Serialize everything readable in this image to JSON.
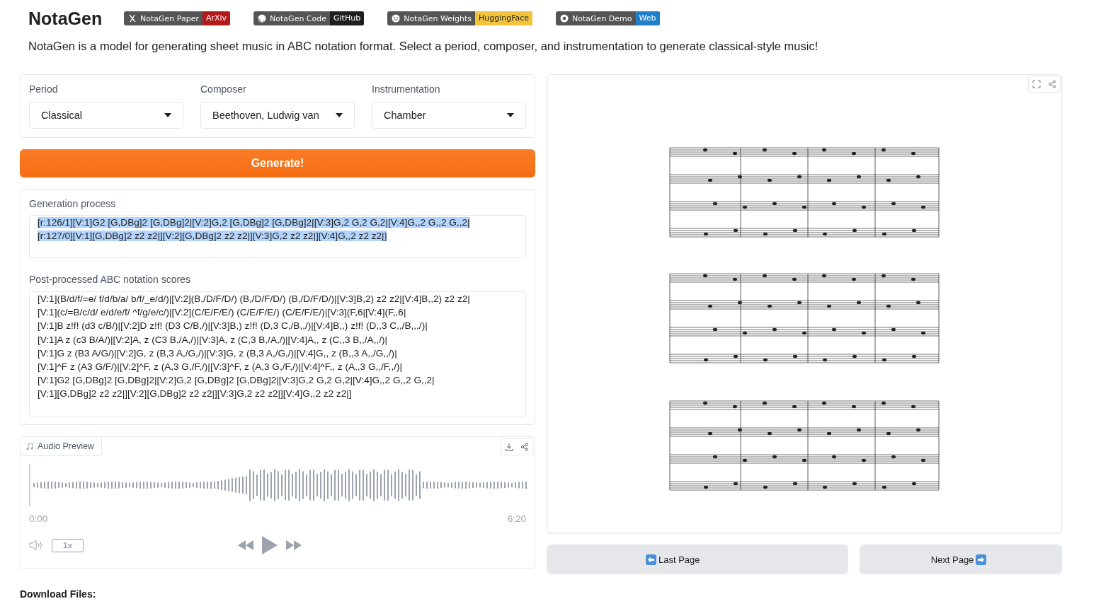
{
  "header": {
    "title": "NotaGen",
    "badges": [
      {
        "kind": "paper",
        "label": "NotaGen Paper",
        "tag": "ArXiv",
        "color": "#b31b1b"
      },
      {
        "kind": "code",
        "label": "NotaGen Code",
        "tag": "GitHub",
        "color": "#1f1f1f"
      },
      {
        "kind": "weights",
        "label": "NotaGen Weights",
        "tag": "HuggingFace",
        "color": "#f2c43d"
      },
      {
        "kind": "demo",
        "label": "NotaGen Demo",
        "tag": "Web",
        "color": "#1f7fc9"
      }
    ],
    "description": "NotaGen is a model for generating sheet music in ABC notation format. Select a period, composer, and instrumentation to generate classical-style music!"
  },
  "selectors": [
    {
      "label": "Period",
      "value": "Classical"
    },
    {
      "label": "Composer",
      "value": "Beethoven, Ludwig van"
    },
    {
      "label": "Instrumentation",
      "value": "Chamber"
    }
  ],
  "generate_button": "Generate!",
  "generation_process": {
    "label": "Generation process",
    "selected": true,
    "lines": [
      "[r:126/1][V:1]G2 [G,DBg]2 [G,DBg]2|[V:2]G,2 [G,DBg]2 [G,DBg]2|[V:3]G,2 G,2 G,2|[V:4]G,,2 G,,2 G,,2|",
      "[r:127/0][V:1][G,DBg]2 z2 z2|][V:2][G,DBg]2 z2 z2|][V:3]G,2 z2 z2|][V:4]G,,2 z2 z2|]"
    ]
  },
  "abc_scores": {
    "label": "Post-processed ABC notation scores",
    "lines": [
      "[V:1](B/d/f/=e/ f/d/b/a/ b/f/_e/d/)|[V:2](B,/D/F/D/) (B,/D/F/D/) (B,/D/F/D/)|[V:3]B,2) z2 z2|[V:4]B,,2) z2 z2|",
      "[V:1](c/=B/c/d/ e/d/e/f/ ^f/g/e/c/)|[V:2](C/E/F/E/) (C/E/F/E/) (C/E/F/E/)|[V:3](F,6|[V:4](F,,6|",
      "[V:1]B z!f! (d3 c/B/)|[V:2]D z!f! (D3 C/B,/)|[V:3]B,) z!f! (D,3 C,/B,,/)|[V:4]B,,) z!f! (D,,3 C,,/B,,,/)|",
      "[V:1]A z (c3 B/A/)|[V:2]A, z (C3 B,/A,/)|[V:3]A, z (C,3 B,/A,/)|[V:4]A,, z (C,,3 B,,/A,,/)|",
      "[V:1]G z (B3 A/G/)|[V:2]G, z (B,3 A,/G,/)|[V:3]G, z (B,3 A,/G,/)|[V:4]G,, z (B,,3 A,,/G,,/)|",
      "[V:1]^F z (A3 G/F/)|[V:2]^F, z (A,3 G,/F,/)|[V:3]^F, z (A,3 G,/F,/)|[V:4]^F,, z (A,,3 G,,/F,,/)|",
      "[V:1]G2 [G,DBg]2 [G,DBg]2|[V:2]G,2 [G,DBg]2 [G,DBg]2|[V:3]G,2 G,2 G,2|[V:4]G,,2 G,,2 G,,2|",
      "[V:1][G,DBg]2 z2 z2|][V:2][G,DBg]2 z2 z2|][V:3]G,2 z2 z2|][V:4]G,,2 z2 z2|]"
    ]
  },
  "audio": {
    "label": "Audio Preview",
    "start_time": "0:00",
    "end_time": "6:20",
    "speed": "1x"
  },
  "score_viewer": {
    "kind": "picture"
  },
  "page_buttons": [
    "Last Page",
    "Next Page"
  ],
  "download_label": "Download Files:"
}
